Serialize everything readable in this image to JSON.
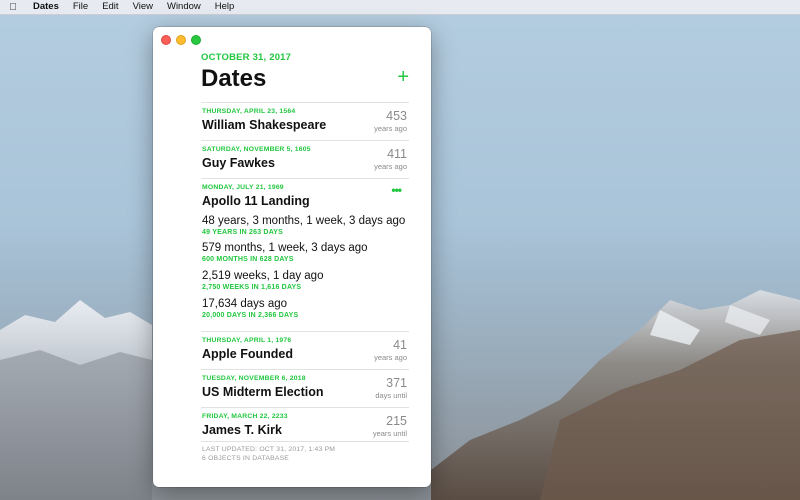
{
  "menubar": {
    "apple_icon": "apple-icon",
    "app_name": "Dates",
    "items": [
      "File",
      "Edit",
      "View",
      "Window",
      "Help"
    ]
  },
  "window": {
    "today_date": "OCTOBER 31, 2017",
    "title": "Dates",
    "add_label": "+",
    "more_label": "•••",
    "accent_color": "#21c73f"
  },
  "dates": [
    {
      "date": "THURSDAY, APRIL 23, 1564",
      "name": "William Shakespeare",
      "value": "453",
      "unit": "years ago"
    },
    {
      "date": "SATURDAY, NOVEMBER 5, 1605",
      "name": "Guy Fawkes",
      "value": "411",
      "unit": "years ago"
    },
    {
      "date": "MONDAY, JULY 21, 1969",
      "name": "Apollo 11 Landing",
      "details": [
        {
          "main": "48 years, 3 months, 1 week, 3 days ago",
          "sub": "49 YEARS IN 263 DAYS"
        },
        {
          "main": "579 months, 1 week, 3 days ago",
          "sub": "600 MONTHS IN 628 DAYS"
        },
        {
          "main": "2,519 weeks, 1 day ago",
          "sub": "2,750 WEEKS IN 1,616 DAYS"
        },
        {
          "main": "17,634 days ago",
          "sub": "20,000 DAYS IN 2,366 DAYS"
        }
      ]
    },
    {
      "date": "THURSDAY, APRIL 1, 1976",
      "name": "Apple Founded",
      "value": "41",
      "unit": "years ago"
    },
    {
      "date": "TUESDAY, NOVEMBER 6, 2018",
      "name": "US Midterm Election",
      "value": "371",
      "unit": "days until"
    },
    {
      "date": "FRIDAY, MARCH 22, 2233",
      "name": "James T. Kirk",
      "value": "215",
      "unit": "years until"
    }
  ],
  "footer": {
    "last_updated": "LAST UPDATED: OCT 31, 2017, 1:43 PM",
    "objects": "6 OBJECTS IN DATABASE"
  }
}
